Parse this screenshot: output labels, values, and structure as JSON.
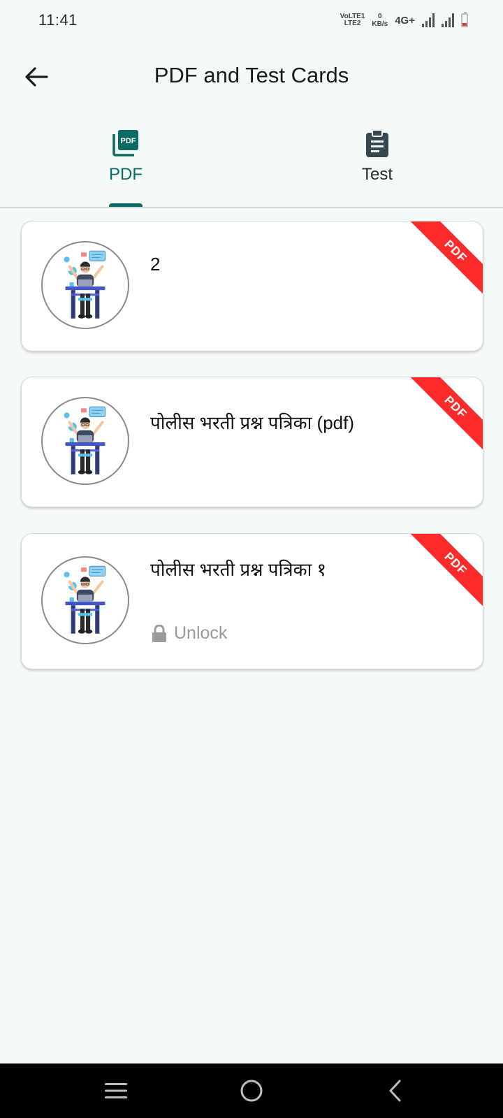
{
  "status_bar": {
    "time": "11:41",
    "volte_line1": "VoLTE1",
    "volte_line2": "LTE2",
    "speed_value": "0",
    "speed_unit": "KB/s",
    "network": "4G+",
    "battery_level": 0.15
  },
  "app_bar": {
    "title": "PDF and Test Cards",
    "back_icon": "arrow-left-icon"
  },
  "tabs": [
    {
      "label": "PDF",
      "icon": "pdf-icon",
      "active": true
    },
    {
      "label": "Test",
      "icon": "clipboard-icon",
      "active": false
    }
  ],
  "cards": [
    {
      "title": "2",
      "ribbon": "PDF",
      "locked": false
    },
    {
      "title": "पोलीस भरती प्रश्न पत्रिका (pdf)",
      "ribbon": "PDF",
      "locked": false
    },
    {
      "title": "पोलीस भरती प्रश्न पत्रिका १",
      "ribbon": "PDF",
      "locked": true,
      "lock_label": "Unlock"
    }
  ],
  "colors": {
    "background": "#f3faf8",
    "accent": "#0e6b63",
    "ribbon": "#ff2a2a",
    "locked_text": "#9a9a9a"
  }
}
